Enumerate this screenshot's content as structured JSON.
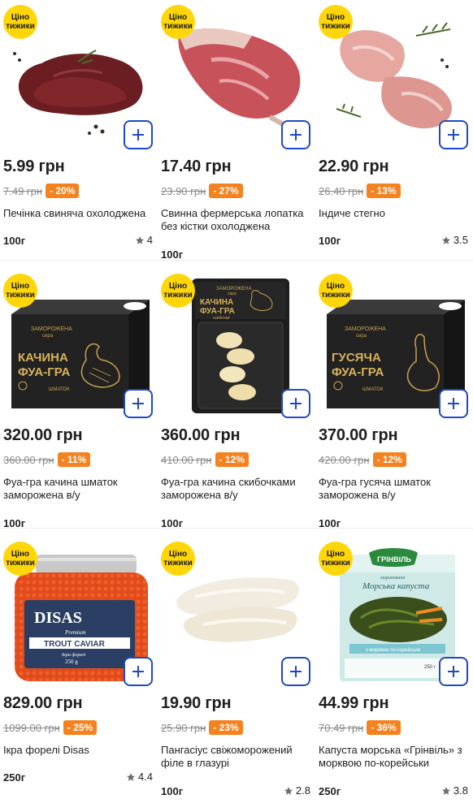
{
  "badge_text": "Ціно тижики",
  "currency": "грн",
  "products": [
    {
      "price": "5.99 грн",
      "old_price": "7.49 грн",
      "discount": "- 20%",
      "name": "Печінка свиняча охолоджена",
      "weight": "100г",
      "rating": "4",
      "image": "pork-liver"
    },
    {
      "price": "17.40 грн",
      "old_price": "23.90 грн",
      "discount": "- 27%",
      "name": "Свинна фермерська лопатка без кістки охолоджена",
      "weight": "100г",
      "rating": "",
      "image": "pork-shoulder"
    },
    {
      "price": "22.90 грн",
      "old_price": "26.40 грн",
      "discount": "- 13%",
      "name": "Індиче стегно",
      "weight": "100г",
      "rating": "3.5",
      "image": "turkey-thigh"
    },
    {
      "price": "320.00 грн",
      "old_price": "360.00 грн",
      "discount": "- 11%",
      "name": "Фуа-гра качина шматок заморожена в/у",
      "weight": "100г",
      "rating": "",
      "image": "duck-foie-gras-box"
    },
    {
      "price": "360.00 грн",
      "old_price": "410.00 грн",
      "discount": "- 12%",
      "name": "Фуа-гра качина скибочками заморожена в/у",
      "weight": "100г",
      "rating": "",
      "image": "duck-foie-gras-slices"
    },
    {
      "price": "370.00 грн",
      "old_price": "420.00 грн",
      "discount": "- 12%",
      "name": "Фуа-гра гусяча шматок заморожена в/у",
      "weight": "100г",
      "rating": "",
      "image": "goose-foie-gras-box"
    },
    {
      "price": "829.00 грн",
      "old_price": "1099.00 грн",
      "discount": "- 25%",
      "name": "Ікра форелі Disas",
      "weight": "250г",
      "rating": "4.4",
      "image": "trout-caviar-jar"
    },
    {
      "price": "19.90 грн",
      "old_price": "25.90 грн",
      "discount": "- 23%",
      "name": "Пангасіус свіжоморожений філе в глазурі",
      "weight": "100г",
      "rating": "2.8",
      "image": "pangasius-fillet"
    },
    {
      "price": "44.99 грн",
      "old_price": "70.49 грн",
      "discount": "- 36%",
      "name": "Капуста морська «Грінвіль» з морквою по-корейськи",
      "weight": "250г",
      "rating": "3.8",
      "image": "seaweed-salad-pack"
    }
  ],
  "package_text": {
    "duck_box_top": "ЗАМОРОЖЕНА",
    "duck_box_top2": "сира",
    "duck_box_title1": "КАЧИНА",
    "duck_box_title2": "ФУА-ГРА",
    "duck_box_sub": "ШМАТОК",
    "duck_slices_top": "ЗАМОРОЖЕНА",
    "duck_slices_top2": "сира",
    "duck_slices_title1": "КАЧИНА",
    "duck_slices_title2": "ФУА-ГРА",
    "duck_slices_sub": "скибочки",
    "goose_box_top": "ЗАМОРОЖЕНА",
    "goose_box_top2": "сира",
    "goose_box_title1": "ГУСЯЧА",
    "goose_box_title2": "ФУА-ГРА",
    "goose_box_sub": "ШМАТОК",
    "caviar_brand": "DISAS",
    "caviar_premium": "Premium",
    "caviar_label": "TROUT CAVIAR",
    "caviar_sub": "Ікра форелі",
    "caviar_weight": "250 g",
    "seaweed_brand": "ГРІНВІЛЬ",
    "seaweed_top": "маринована",
    "seaweed_title": "Морська капуста",
    "seaweed_sub": "з морквою по-корейськи",
    "seaweed_weight": "250 г"
  },
  "colors": {
    "badge": "#ffd60a",
    "add_border": "#1f49c4",
    "discount": "#f58220"
  }
}
